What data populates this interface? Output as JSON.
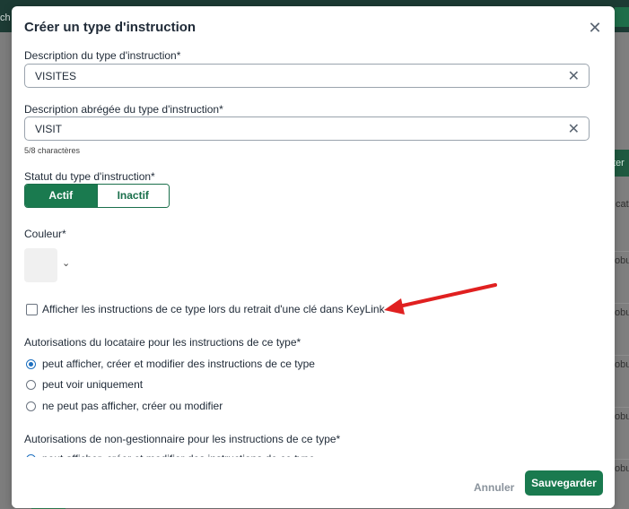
{
  "background": {
    "left_text": "ch",
    "right_icon": "edit-icon",
    "button_fragment": "ter",
    "column_fragment": "cat",
    "row_fragments": [
      "obu",
      "obu",
      "obu",
      "obu",
      "obu"
    ]
  },
  "modal": {
    "title": "Créer un type d'instruction",
    "close_icon": "close-icon"
  },
  "form": {
    "description": {
      "label": "Description du type d'instruction*",
      "value": "VISITES"
    },
    "short_description": {
      "label": "Description abrégée du type d'instruction*",
      "value": "VISIT",
      "hint": "5/8 charactères"
    },
    "status": {
      "label": "Statut du type d'instruction*",
      "options": [
        "Actif",
        "Inactif"
      ],
      "selected": "Actif"
    },
    "color": {
      "label": "Couleur*",
      "swatch": "#f0f0f0"
    },
    "keylink_checkbox": {
      "label": "Afficher les instructions de ce type lors du retrait d'une clé dans KeyLink",
      "checked": false
    },
    "tenant_permissions": {
      "label": "Autorisations du locataire pour les instructions de ce type*",
      "options": [
        "peut afficher, créer et modifier des instructions de ce type",
        "peut voir uniquement",
        "ne peut pas afficher, créer ou modifier"
      ],
      "selected_index": 0
    },
    "non_manager_permissions": {
      "label": "Autorisations de non-gestionnaire pour les instructions de ce type*",
      "options": [
        "peut afficher, créer et modifier des instructions de ce type"
      ]
    }
  },
  "footer": {
    "cancel_label": "Annuler",
    "save_label": "Sauvegarder"
  },
  "colors": {
    "accent": "#1a7a4f",
    "radio": "#1d6fbf",
    "annotation_arrow": "#e02020"
  }
}
